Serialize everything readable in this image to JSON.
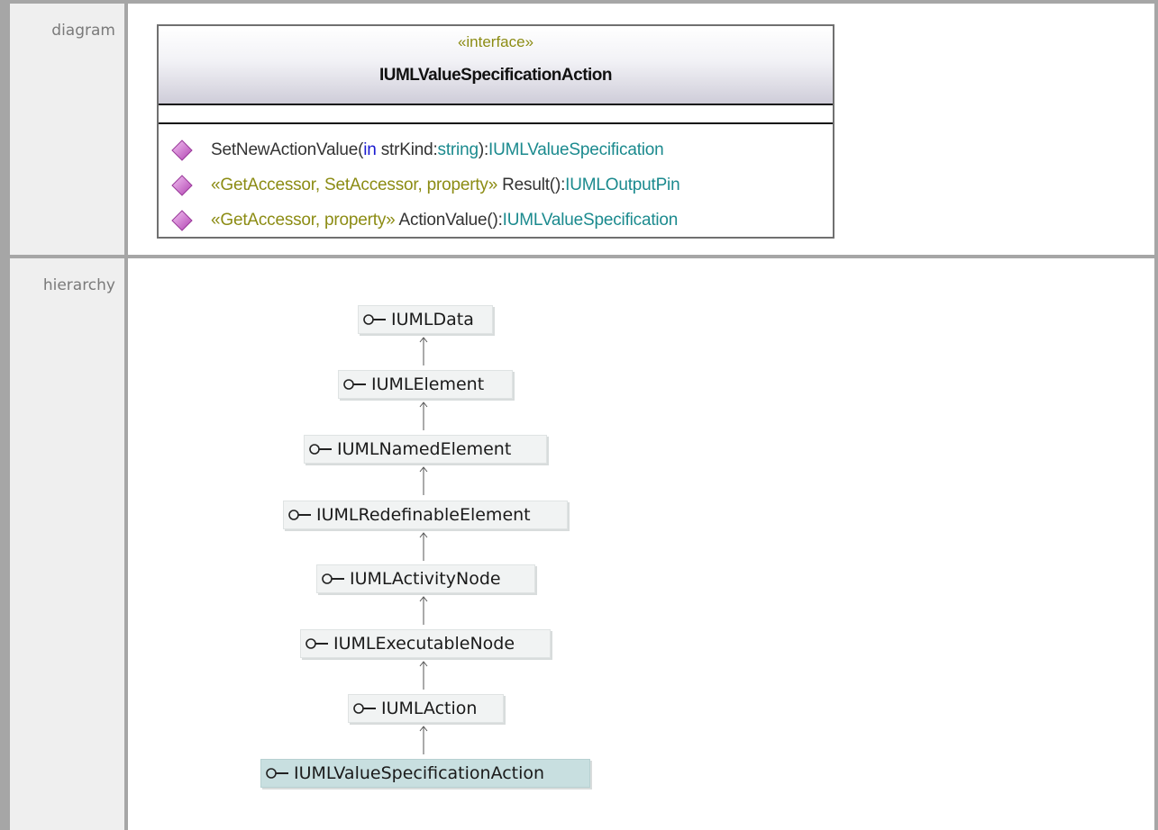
{
  "rows": {
    "diagram_label": "diagram",
    "hierarchy_label": "hierarchy"
  },
  "interface_box": {
    "stereotype": "«interface»",
    "name": "IUMLValueSpecificationAction",
    "operations": [
      {
        "name": "SetNewActionValue(",
        "param_keyword": "in",
        "param": " strKind:",
        "param_type": "string",
        "close": "):",
        "return_type": "IUMLValueSpecification"
      },
      {
        "stereotype": "«GetAccessor, SetAccessor, property»",
        "name": " Result():",
        "return_type": "IUMLOutputPin"
      },
      {
        "stereotype": "«GetAccessor, property»",
        "name": " ActionValue():",
        "return_type": "IUMLValueSpecification"
      }
    ]
  },
  "hierarchy": [
    "IUMLData",
    "IUMLElement",
    "IUMLNamedElement",
    "IUMLRedefinableElement",
    "IUMLActivityNode",
    "IUMLExecutableNode",
    "IUMLAction",
    "IUMLValueSpecificationAction"
  ],
  "colors": {
    "stereotype": "#8c8c14",
    "type": "#1b8a8e",
    "keyword": "#1a1ad0",
    "operation_icon": "#cc66cc",
    "current_node": "#c8dfe0",
    "node": "#f1f3f3"
  },
  "icons": {
    "operation": "public-operation-diamond-icon",
    "interface": "interface-lollipop-icon",
    "generalization": "generalization-arrow-icon"
  }
}
